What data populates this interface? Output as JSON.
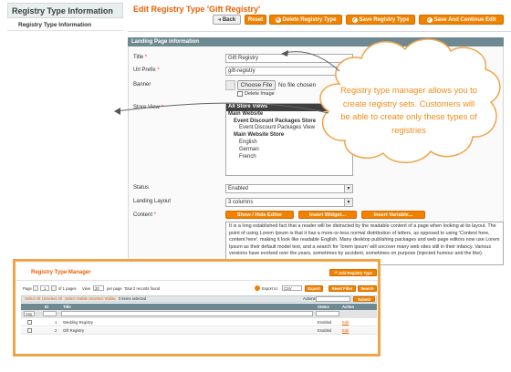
{
  "sidebar": {
    "title": "Registry Type Information",
    "items": [
      {
        "label": "Registry Type Information"
      }
    ]
  },
  "header": {
    "title": "Edit Registry Type 'Gift Registry'",
    "buttons": {
      "back": "Back",
      "reset": "Reset",
      "delete": "Delete Registry Type",
      "save": "Save Registry Type",
      "save_continue": "Save And Continue Edit"
    }
  },
  "form": {
    "section_title": "Landing Page information",
    "title_label": "Title",
    "title_value": "Gift Registry",
    "url_prefix_label": "Url Prefix",
    "url_prefix_value": "gift-registry",
    "banner_label": "Banner",
    "choose_file": "Choose File",
    "no_file": "No file chosen",
    "delete_image": "Delete Image",
    "store_view_label": "Store View",
    "store_views": [
      {
        "label": "All Store Views",
        "level": 0,
        "selected": true,
        "bold": true
      },
      {
        "label": "Main Website",
        "level": 0,
        "selected": false,
        "bold": true
      },
      {
        "label": "Event Discount Packages Store",
        "level": 1,
        "selected": false,
        "bold": true
      },
      {
        "label": "Event Discount Packages View",
        "level": 2,
        "selected": false,
        "bold": false
      },
      {
        "label": "Main Website Store",
        "level": 1,
        "selected": false,
        "bold": true
      },
      {
        "label": "English",
        "level": 2,
        "selected": false,
        "bold": false
      },
      {
        "label": "German",
        "level": 2,
        "selected": false,
        "bold": false
      },
      {
        "label": "French",
        "level": 2,
        "selected": false,
        "bold": false
      }
    ],
    "status_label": "Status",
    "status_value": "Enabled",
    "landing_layout_label": "Landing Layout",
    "landing_layout_value": "3 columns",
    "content_label": "Content",
    "wysiwyg_buttons": {
      "toggle": "Show / Hide Editor",
      "widget": "Insert Widget...",
      "variable": "Insert Variable..."
    },
    "content_text": "It is a long established fact that a reader will be distracted by the readable content of a page when looking at its layout. The point of using Lorem Ipsum is that it has a more-or-less normal distribution of letters, as opposed to using 'Content here, content here', making it look like readable English. Many desktop publishing packages and web page editors now use Lorem Ipsum as their default model text, and a search for 'lorem ipsum' will uncover many web sites still in their infancy. Various versions have evolved over the years, sometimes by accident, sometimes on purpose (injected humour and the like)."
  },
  "callout": {
    "text": "Registry type manager allows you to create registry sets. Customers will be able to create only these types of registries",
    "color": "#f08c18"
  },
  "manager": {
    "title": "Registry Type Manager",
    "add_button": "Add Registry Type",
    "page_label": "Page",
    "page_value": "1",
    "of_pages": "of 1 pages",
    "view_label": "View",
    "per_page_value": "20",
    "per_page_label": "per page",
    "total_records": "Total 2 records found",
    "export_to": "Export to:",
    "export_format": "CSV",
    "export_button": "Export",
    "reset_filter": "Reset Filter",
    "search": "Search",
    "mass_links": [
      "Select All",
      "Unselect All",
      "Select Visible",
      "Unselect Visible"
    ],
    "items_selected": "0 items selected",
    "actions_label": "Actions",
    "submit": "Submit",
    "columns": {
      "id": "ID",
      "title": "Title",
      "status": "Status",
      "action": "Action"
    },
    "filter_any": "Any",
    "rows": [
      {
        "id": "1",
        "title": "Wedding Registry",
        "status": "Enabled",
        "action": "Edit"
      },
      {
        "id": "2",
        "title": "Gift Registry",
        "status": "Enabled",
        "action": "Edit"
      }
    ]
  },
  "colors": {
    "accent": "#eb5e00",
    "button": "#f18200",
    "section_header": "#6f8992",
    "overlay_border": "#f0a448"
  }
}
